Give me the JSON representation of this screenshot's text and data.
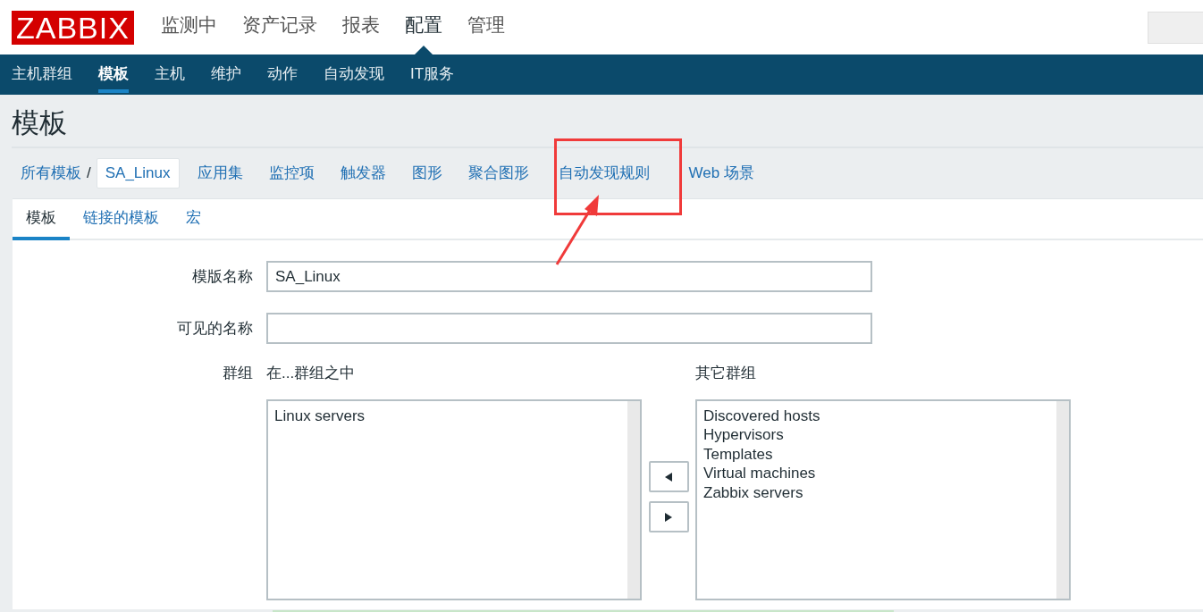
{
  "header": {
    "logo": "ZABBIX",
    "menu": [
      {
        "label": "监测中",
        "selected": false
      },
      {
        "label": "资产记录",
        "selected": false
      },
      {
        "label": "报表",
        "selected": false
      },
      {
        "label": "配置",
        "selected": true
      },
      {
        "label": "管理",
        "selected": false
      }
    ]
  },
  "subnav": [
    {
      "label": "主机群组",
      "selected": false
    },
    {
      "label": "模板",
      "selected": true
    },
    {
      "label": "主机",
      "selected": false
    },
    {
      "label": "维护",
      "selected": false
    },
    {
      "label": "动作",
      "selected": false
    },
    {
      "label": "自动发现",
      "selected": false
    },
    {
      "label": "IT服务",
      "selected": false
    }
  ],
  "page_title": "模板",
  "breadcrumb": [
    {
      "label": "所有模板",
      "kind": "link"
    },
    {
      "label": "/",
      "kind": "separator"
    },
    {
      "label": "SA_Linux",
      "kind": "current"
    }
  ],
  "template_links": [
    "应用集",
    "监控项",
    "触发器",
    "图形",
    "聚合图形",
    "自动发现规则",
    "Web 场景"
  ],
  "form_tabs": [
    {
      "label": "模板",
      "selected": true
    },
    {
      "label": "链接的模板",
      "selected": false
    },
    {
      "label": "宏",
      "selected": false
    }
  ],
  "fields": [
    {
      "label": "模版名称",
      "value": "SA_Linux"
    },
    {
      "label": "可见的名称"
    }
  ],
  "groups": {
    "label": "群组",
    "in_groups": {
      "title": "在...群组之中",
      "items": [
        "Linux servers"
      ]
    },
    "other_groups": {
      "title": "其它群组",
      "items": [
        "Discovered hosts",
        "Hypervisors",
        "Templates",
        "Virtual machines",
        "Zabbix servers"
      ]
    }
  }
}
